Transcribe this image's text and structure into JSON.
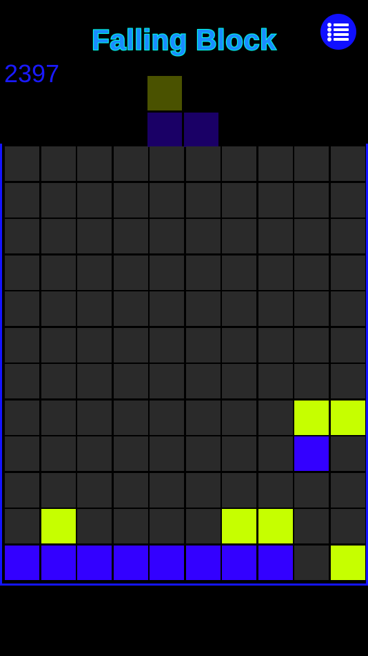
{
  "header": {
    "title": "Falling Block",
    "score": "2397"
  },
  "menu": {
    "icon": "list-icon"
  },
  "colors": {
    "empty": "#2a2a2a",
    "lime": "#c6ff00",
    "blue": "#3300ff",
    "next_lime": "#4a5200",
    "next_blue": "#1a0066"
  },
  "next_piece": {
    "cells": [
      {
        "col": 4,
        "row": 0,
        "color": "next_lime"
      },
      {
        "col": 4,
        "row": 1,
        "color": "next_blue"
      },
      {
        "col": 5,
        "row": 1,
        "color": "next_blue"
      }
    ]
  },
  "board": {
    "cols": 10,
    "rows": 12,
    "filled": [
      {
        "col": 8,
        "row": 7,
        "color": "lime"
      },
      {
        "col": 9,
        "row": 7,
        "color": "lime"
      },
      {
        "col": 8,
        "row": 8,
        "color": "blue"
      },
      {
        "col": 1,
        "row": 10,
        "color": "lime"
      },
      {
        "col": 6,
        "row": 10,
        "color": "lime"
      },
      {
        "col": 7,
        "row": 10,
        "color": "lime"
      },
      {
        "col": 0,
        "row": 11,
        "color": "blue"
      },
      {
        "col": 1,
        "row": 11,
        "color": "blue"
      },
      {
        "col": 2,
        "row": 11,
        "color": "blue"
      },
      {
        "col": 3,
        "row": 11,
        "color": "blue"
      },
      {
        "col": 4,
        "row": 11,
        "color": "blue"
      },
      {
        "col": 5,
        "row": 11,
        "color": "blue"
      },
      {
        "col": 6,
        "row": 11,
        "color": "blue"
      },
      {
        "col": 7,
        "row": 11,
        "color": "blue"
      },
      {
        "col": 9,
        "row": 11,
        "color": "lime"
      }
    ]
  }
}
